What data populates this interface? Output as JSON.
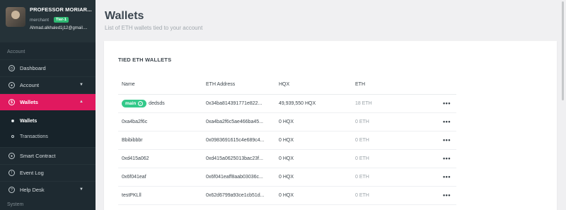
{
  "profile": {
    "name": "PROFESSOR MORIAR...",
    "role": "merchant",
    "tier": "Tier-1",
    "email": "Ahmad.alkhaled1j12@gmail...."
  },
  "sidebar": {
    "section_account": "Account",
    "section_system": "System",
    "items": [
      {
        "label": "Dashboard"
      },
      {
        "label": "Account"
      },
      {
        "label": "Wallets"
      },
      {
        "label": "Smart Contract"
      },
      {
        "label": "Event Log"
      },
      {
        "label": "Help Desk"
      }
    ],
    "sub_items": [
      {
        "label": "Wallets"
      },
      {
        "label": "Transactions"
      }
    ]
  },
  "page": {
    "title": "Wallets",
    "subtitle": "List of ETH wallets tied to your account"
  },
  "card": {
    "title": "TIED ETH WALLETS",
    "columns": [
      "Name",
      "ETH Address",
      "HQX",
      "ETH"
    ],
    "main_badge": "main",
    "rows": [
      {
        "name": "dedsds",
        "address": "0x34ba814391771e822...",
        "hqx": "49,939,550 HQX",
        "eth": "18 ETH",
        "more": "•••"
      },
      {
        "name": "0xa4ba2f6c",
        "address": "0xa4ba2f6c5ae466ba45...",
        "hqx": "0 HQX",
        "eth": "0 ETH",
        "more": "•••"
      },
      {
        "name": "Bbibibbbr",
        "address": "0x0983691615c4e689c4...",
        "hqx": "0 HQX",
        "eth": "0 ETH",
        "more": "•••"
      },
      {
        "name": "0xd415a062",
        "address": "0xd415a0625013bac23f...",
        "hqx": "0 HQX",
        "eth": "0 ETH",
        "more": "•••"
      },
      {
        "name": "0x6f041eaf",
        "address": "0x6f041eaff8aab03036c...",
        "hqx": "0 HQX",
        "eth": "0 ETH",
        "more": "•••"
      },
      {
        "name": "testPKLll",
        "address": "0x62d6799a93ce1cb51d...",
        "hqx": "0 HQX",
        "eth": "0 ETH",
        "more": "•••"
      }
    ]
  },
  "colors": {
    "accent": "#e0195f",
    "sidebar_bg": "#1e2a31",
    "badge_green": "#33c98a",
    "tier_green": "#2eb872"
  }
}
